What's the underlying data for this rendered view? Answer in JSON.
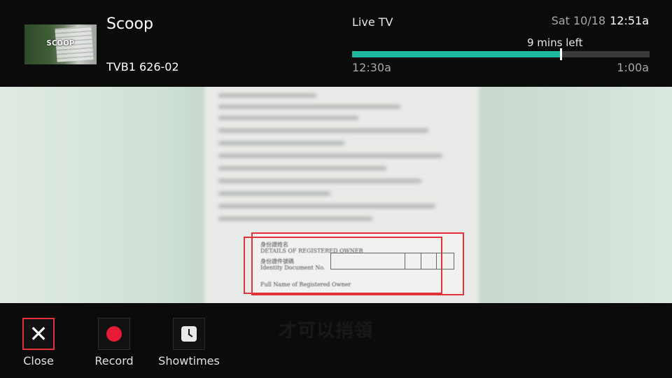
{
  "program": {
    "thumbnail_text": "SCOOP",
    "title": "Scoop",
    "channel": "TVB1 626-02"
  },
  "status": {
    "mode": "Live TV",
    "date": "Sat 10/18",
    "time": "12:51a",
    "remaining": "9 mins left",
    "start_time": "12:30a",
    "end_time": "1:00a",
    "progress_fraction": 0.7,
    "progress_color": "#1fb9a0"
  },
  "video": {
    "doc_lines": [
      "身份證姓名",
      "DETAILS OF REGISTERED OWNER",
      "身份證件號碼",
      "Identity Document No.",
      "Full Name of Registered Owner"
    ],
    "subtitle": "才可以捎領"
  },
  "actions": [
    {
      "label": "Close",
      "icon": "close-icon",
      "selected": true
    },
    {
      "label": "Record",
      "icon": "record-icon",
      "selected": false
    },
    {
      "label": "Showtimes",
      "icon": "clock-icon",
      "selected": false
    }
  ],
  "colors": {
    "accent": "#1fb9a0",
    "record": "#e81b36",
    "selection": "#e2333b"
  }
}
